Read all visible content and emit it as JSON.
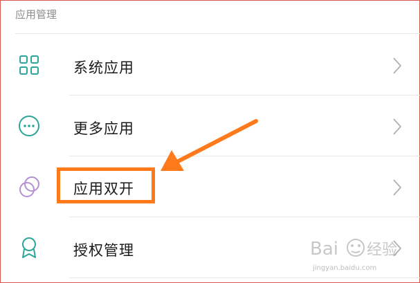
{
  "section": {
    "title": "应用管理"
  },
  "items": [
    {
      "label": "系统应用",
      "icon": "grid-icon"
    },
    {
      "label": "更多应用",
      "icon": "more-circle-icon"
    },
    {
      "label": "应用双开",
      "icon": "dual-circles-icon"
    },
    {
      "label": "授权管理",
      "icon": "badge-icon"
    }
  ],
  "colors": {
    "icon_teal": "#2aa59a",
    "icon_purple": "#b48fd6",
    "highlight": "#ff7a1a",
    "frame": "#d9534f"
  },
  "watermark": {
    "text": "jingyan.baidu.com",
    "logo": "baidu-jingyan-logo"
  }
}
